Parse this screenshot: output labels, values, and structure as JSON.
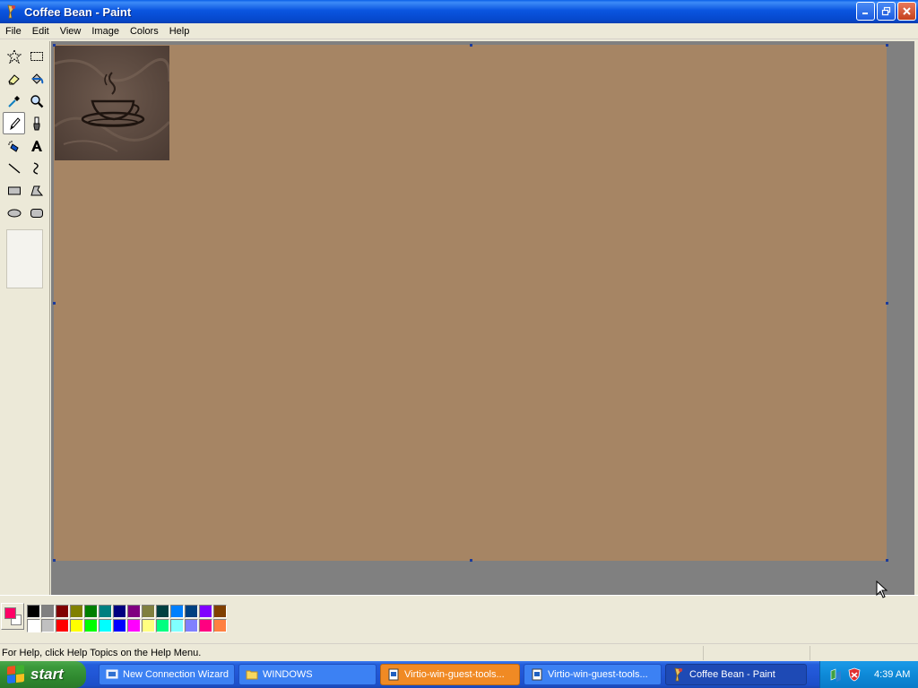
{
  "window": {
    "title": "Coffee Bean - Paint"
  },
  "menu": [
    "File",
    "Edit",
    "View",
    "Image",
    "Colors",
    "Help"
  ],
  "tools": [
    {
      "name": "free-form-select-tool",
      "icon": "star-select-icon"
    },
    {
      "name": "select-tool",
      "icon": "rect-select-icon"
    },
    {
      "name": "eraser-tool",
      "icon": "eraser-icon"
    },
    {
      "name": "fill-tool",
      "icon": "fill-bucket-icon"
    },
    {
      "name": "pick-color-tool",
      "icon": "eyedropper-icon"
    },
    {
      "name": "magnifier-tool",
      "icon": "magnifier-icon"
    },
    {
      "name": "pencil-tool",
      "icon": "pencil-icon"
    },
    {
      "name": "brush-tool",
      "icon": "brush-icon"
    },
    {
      "name": "airbrush-tool",
      "icon": "airbrush-icon"
    },
    {
      "name": "text-tool",
      "icon": "text-icon"
    },
    {
      "name": "line-tool",
      "icon": "line-icon"
    },
    {
      "name": "curve-tool",
      "icon": "curve-icon"
    },
    {
      "name": "rectangle-tool",
      "icon": "rectangle-icon"
    },
    {
      "name": "polygon-tool",
      "icon": "polygon-icon"
    },
    {
      "name": "ellipse-tool",
      "icon": "ellipse-icon"
    },
    {
      "name": "rounded-rectangle-tool",
      "icon": "rounded-rectangle-icon"
    }
  ],
  "active_tool": "pencil-tool",
  "colors": {
    "foreground": "#ff0066",
    "background": "#ffffff",
    "canvas": "#a68564",
    "palette_top": [
      "#000000",
      "#808080",
      "#800000",
      "#808000",
      "#008000",
      "#008080",
      "#000080",
      "#800080",
      "#808040",
      "#004040",
      "#0080ff",
      "#004080",
      "#8000ff",
      "#804000"
    ],
    "palette_bottom": [
      "#ffffff",
      "#c0c0c0",
      "#ff0000",
      "#ffff00",
      "#00ff00",
      "#00ffff",
      "#0000ff",
      "#ff00ff",
      "#ffff80",
      "#00ff80",
      "#80ffff",
      "#8080ff",
      "#ff0080",
      "#ff8040"
    ]
  },
  "status": {
    "help_text": "For Help, click Help Topics on the Help Menu."
  },
  "taskbar": {
    "start_label": "start",
    "tasks": [
      {
        "label": "New Connection Wizard",
        "icon": "network-wizard-icon",
        "state": "normal"
      },
      {
        "label": "WINDOWS",
        "icon": "folder-icon",
        "state": "normal"
      },
      {
        "label": "Virtio-win-guest-tools...",
        "icon": "installer-icon",
        "state": "flash"
      },
      {
        "label": "Virtio-win-guest-tools...",
        "icon": "installer-icon",
        "state": "normal"
      },
      {
        "label": "Coffee Bean - Paint",
        "icon": "paint-icon",
        "state": "active"
      }
    ],
    "clock": "4:39 AM"
  }
}
